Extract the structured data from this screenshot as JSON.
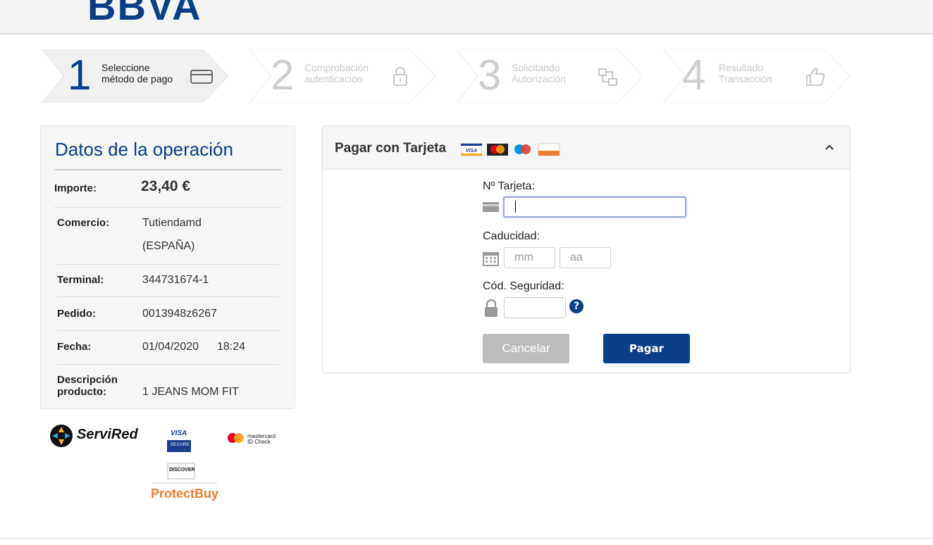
{
  "brand": {
    "logo_text": "BBVA"
  },
  "steps": [
    {
      "number": "1",
      "line1": "Seleccione",
      "line2": "método de pago",
      "icon": "credit-card-icon",
      "active": true
    },
    {
      "number": "2",
      "line1": "Comprobación",
      "line2": "autenticación",
      "icon": "lock-icon",
      "active": false
    },
    {
      "number": "3",
      "line1": "Solicitando",
      "line2": "Autorización",
      "icon": "network-icon",
      "active": false
    },
    {
      "number": "4",
      "line1": "Resultado",
      "line2": "Transacción",
      "icon": "thumbs-up-icon",
      "active": false
    }
  ],
  "operation": {
    "title": "Datos de la operación",
    "amount_label": "Importe:",
    "amount_value": "23,40 €",
    "merchant_label": "Comercio:",
    "merchant_line1": "Tutiendamd",
    "merchant_line2": "(ESPAÑA)",
    "terminal_label": "Terminal:",
    "terminal_value": "344731674-1",
    "order_label": "Pedido:",
    "order_value": "0013948z6267",
    "date_label": "Fecha:",
    "date_value": "01/04/2020",
    "time_value": "18:24",
    "description_label_line1": "Descripción",
    "description_label_line2": "producto:",
    "description_value": "1 JEANS MOM FIT"
  },
  "security_logos": {
    "servired": "ServiRed",
    "visa": "VISA",
    "visa_secure": "SECURE",
    "mastercard": "mastercard",
    "mastercard_id": "ID Check",
    "discover": "DISCOVER",
    "protectbuy": "ProtectBuy"
  },
  "payment": {
    "title": "Pagar con Tarjeta",
    "card_brands": [
      "VISA",
      "mastercard",
      "maestro",
      "DISCOVER"
    ],
    "card_number_label": "Nº Tarjeta:",
    "card_number_value": "",
    "expiry_label": "Caducidad:",
    "expiry_month_placeholder": "mm",
    "expiry_year_placeholder": "aa",
    "cvv_label": "Cód. Seguridad:",
    "cvv_value": "",
    "help_glyph": "?",
    "cancel_label": "Cancelar",
    "pay_label": "Pagar"
  },
  "colors": {
    "brand_blue": "#0a3e87",
    "cancel_gray": "#bcbcbc"
  }
}
